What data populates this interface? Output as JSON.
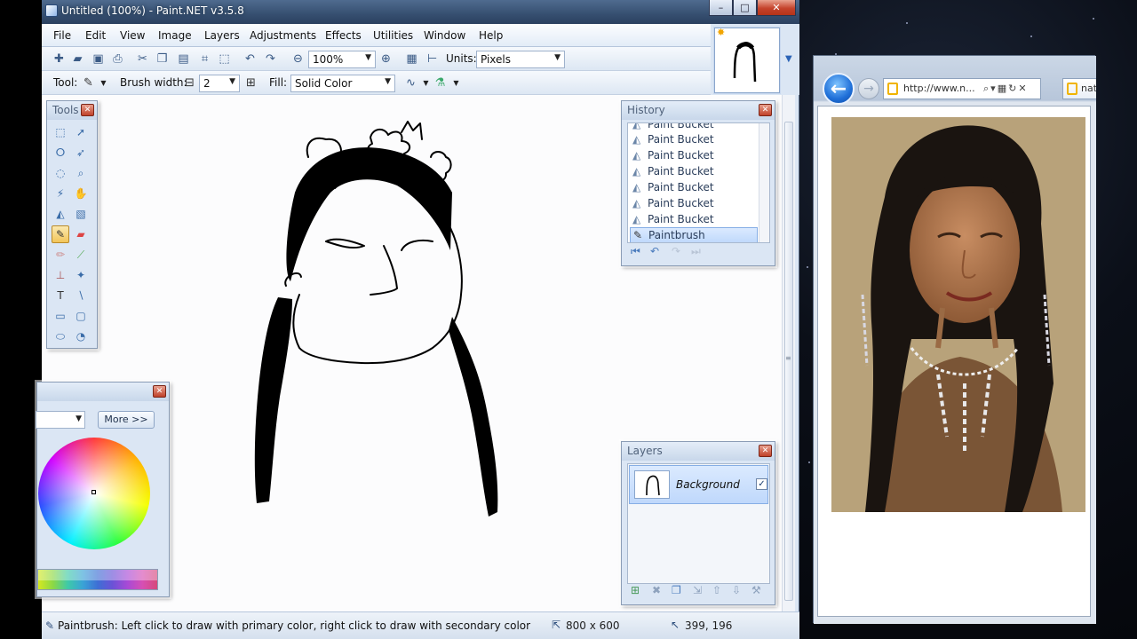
{
  "window": {
    "title": "Untitled (100%) - Paint.NET v3.5.8",
    "controls": {
      "minimize": "–",
      "maximize": "□",
      "close": "✕"
    }
  },
  "menu": [
    "File",
    "Edit",
    "View",
    "Image",
    "Layers",
    "Adjustments",
    "Effects",
    "Utilities",
    "Window",
    "Help"
  ],
  "toolbar": {
    "zoom_value": "100%",
    "units_label": "Units:",
    "units_value": "Pixels",
    "tool_label": "Tool:",
    "brush_width_label": "Brush width:",
    "brush_width_value": "2",
    "fill_label": "Fill:",
    "fill_value": "Solid Color"
  },
  "panels": {
    "tools_title": "Tools",
    "history_title": "History",
    "history_items": [
      "Paint Bucket",
      "Paint Bucket",
      "Paint Bucket",
      "Paint Bucket",
      "Paint Bucket",
      "Paint Bucket",
      "Paint Bucket",
      "Paintbrush"
    ],
    "layers_title": "Layers",
    "layer_name": "Background",
    "layer_visible": true,
    "colors_more_button": "More >>"
  },
  "status": {
    "message": "Paintbrush: Left click to draw with primary color, right click to draw with secondary color",
    "image_size": "800 x 600",
    "cursor_position": "399, 196"
  },
  "browser": {
    "address": "http://www.n...",
    "tab_label": "nat"
  },
  "colors": {
    "accent": "#2b63b6",
    "titlebar": "#3b5677",
    "selection": "#c0d9fb"
  }
}
